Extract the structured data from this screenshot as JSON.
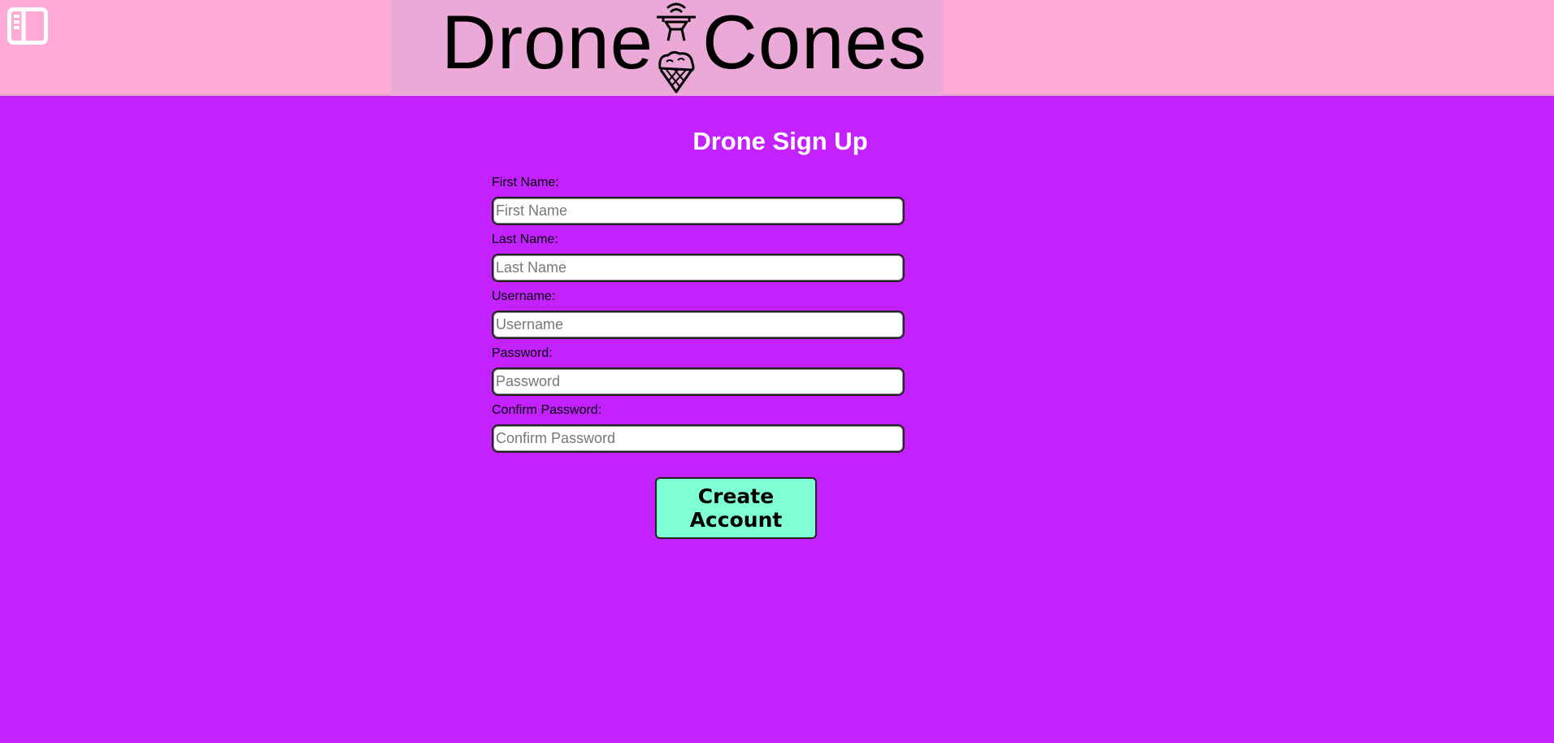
{
  "header": {
    "logo_left": "Drone",
    "logo_right": "Cones",
    "background_color": "#ffaad6",
    "logo_background_color": "#eaa9d6"
  },
  "page": {
    "background_color": "#c322ff",
    "title": "Drone Sign Up"
  },
  "form": {
    "fields": [
      {
        "label": "First Name:",
        "placeholder": "First Name",
        "value": ""
      },
      {
        "label": "Last Name:",
        "placeholder": "Last Name",
        "value": ""
      },
      {
        "label": "Username:",
        "placeholder": "Username",
        "value": ""
      },
      {
        "label": "Password:",
        "placeholder": "Password",
        "value": ""
      },
      {
        "label": "Confirm Password:",
        "placeholder": "Confirm Password",
        "value": ""
      }
    ],
    "submit_label": "Create Account",
    "submit_color": "#7fffd4"
  },
  "icons": {
    "sidebar_toggle": "sidebar-panel-icon",
    "logo": "drone-with-ice-cream-cone-icon"
  }
}
